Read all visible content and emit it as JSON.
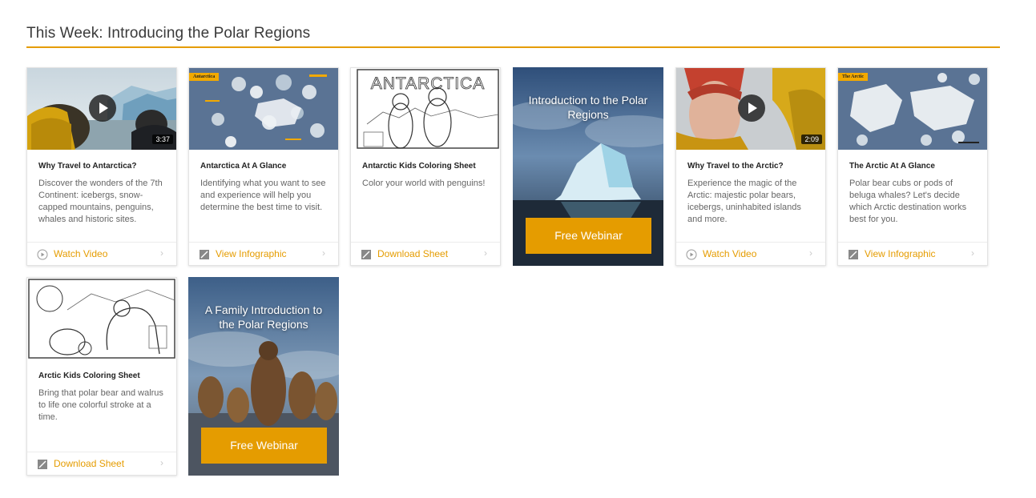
{
  "section": {
    "title": "This Week: Introducing the Polar Regions"
  },
  "cards": [
    {
      "title": "Why Travel to Antarctica?",
      "desc": "Discover the wonders of the 7th Continent: icebergs, snow-capped mountains, penguins, whales and historic sites.",
      "action": "Watch Video",
      "duration": "3:37",
      "icon": "play-circle-icon"
    },
    {
      "title": "Antarctica At A Glance",
      "desc": "Identifying what you want to see and experience will help you determine the best time to visit.",
      "action": "View Infographic",
      "tag": "Antarctica",
      "icon": "infographic-icon"
    },
    {
      "title": "Antarctic Kids Coloring Sheet",
      "desc": "Color your world with penguins!",
      "action": "Download Sheet",
      "thumb_text": "ANTARCTICA",
      "icon": "download-sheet-icon"
    },
    {
      "title": "Why Travel to the Arctic?",
      "desc": "Experience the magic of the Arctic: majestic polar bears, icebergs, uninhabited islands and more.",
      "action": "Watch Video",
      "duration": "2:09",
      "icon": "play-circle-icon"
    },
    {
      "title": "The Arctic At A Glance",
      "desc": "Polar bear cubs or pods of beluga whales? Let's decide which Arctic destination works best for you.",
      "action": "View Infographic",
      "tag": "The Arctic",
      "icon": "infographic-icon"
    },
    {
      "title": "Arctic Kids Coloring Sheet",
      "desc": "Bring that polar bear and walrus to life one colorful stroke at a time.",
      "action": "Download Sheet",
      "icon": "download-sheet-icon"
    }
  ],
  "promos": [
    {
      "title": "Introduction to the Polar Regions",
      "button": "Free Webinar"
    },
    {
      "title": "A Family Introduction to the Polar Regions",
      "button": "Free Webinar"
    }
  ],
  "colors": {
    "accent": "#e59c00",
    "infographic_bg": "#5a7394"
  }
}
